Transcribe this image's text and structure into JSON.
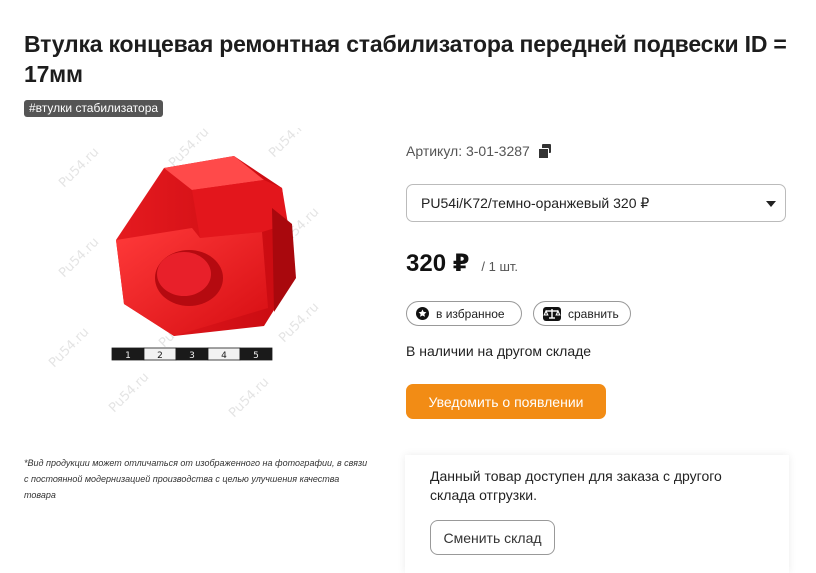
{
  "product": {
    "title": "Втулка концевая ремонтная стабилизатора передней подвески ID = 17мм",
    "tag": "#втулки стабилизатора",
    "sku": "Артикул: 3-01-3287",
    "variant": "PU54i/K72/темно-оранжевый 320 ₽",
    "price": "320 ₽",
    "price_unit": "/ 1 шт.",
    "stock": "В наличии на другом складе",
    "disclaimer": "*Вид продукции может отличаться от изображенного на фотографии, в связи с постоянной модернизацией производства с целью улучшения качества товара"
  },
  "image": {
    "watermark": "Pu54.ru",
    "ruler_marks": [
      "1",
      "2",
      "3",
      "4",
      "5"
    ],
    "part_color": "#e8121a"
  },
  "actions": {
    "favorite": "в избранное",
    "compare": "сравнить",
    "notify": "Уведомить о появлении"
  },
  "warehouse": {
    "message": "Данный товар доступен для заказа с другого склада отгрузки.",
    "change_button": "Сменить склад"
  },
  "colors": {
    "accent": "#f28c15",
    "tag_bg": "#555555"
  }
}
